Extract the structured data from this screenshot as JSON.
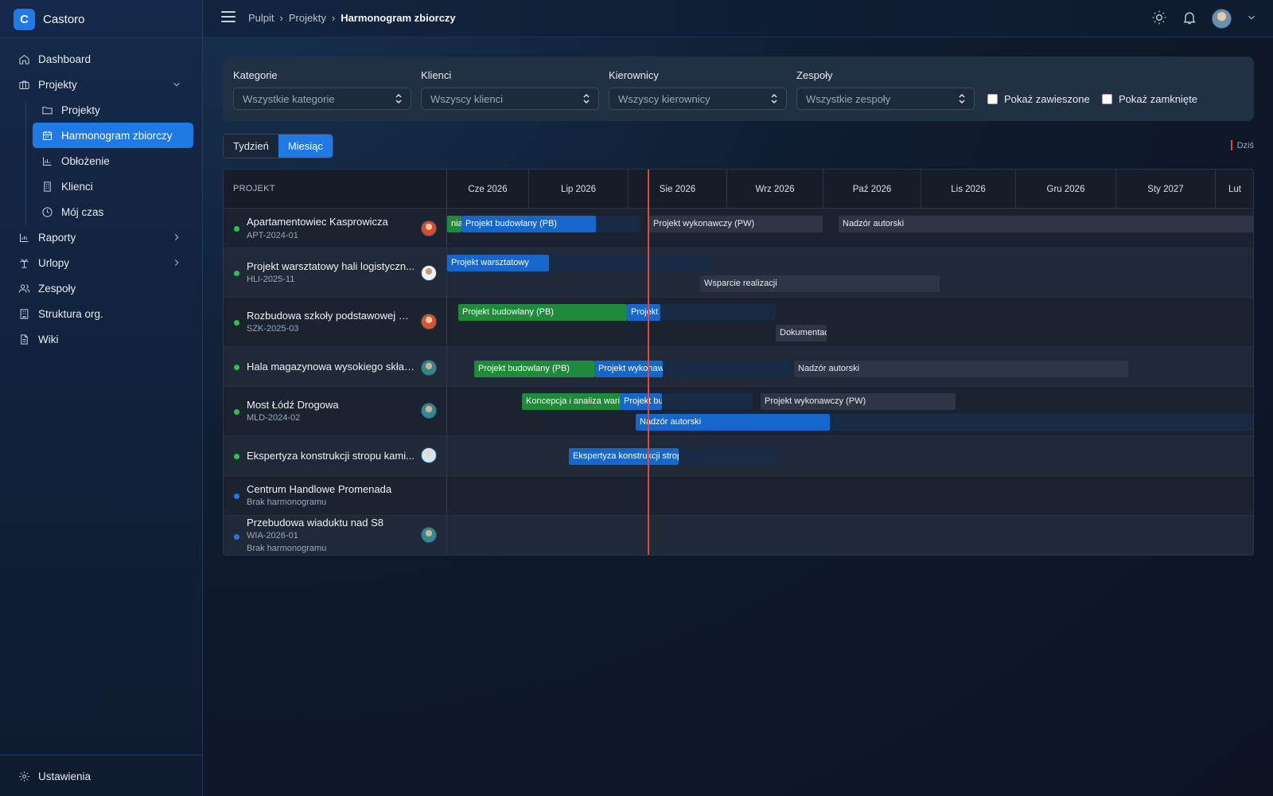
{
  "brand": {
    "letter": "C",
    "name": "Castoro"
  },
  "nav": {
    "dashboard": "Dashboard",
    "projekty": "Projekty",
    "projekty_sub": "Projekty",
    "harmonogram": "Harmonogram zbiorczy",
    "obciazenie": "Obłożenie",
    "klienci": "Klienci",
    "moj_czas": "Mój czas",
    "raporty": "Raporty",
    "urlopy": "Urlopy",
    "zespoly": "Zespoły",
    "struktura": "Struktura org.",
    "wiki": "Wiki",
    "ustawienia": "Ustawienia"
  },
  "breadcrumb": {
    "c1": "Pulpit",
    "c2": "Projekty",
    "c3": "Harmonogram zbiorczy",
    "sep": "›"
  },
  "filters": {
    "kategorie": {
      "label": "Kategorie",
      "value": "Wszystkie kategorie"
    },
    "klienci": {
      "label": "Klienci",
      "value": "Wszyscy klienci"
    },
    "kierownicy": {
      "label": "Kierownicy",
      "value": "Wszyscy kierownicy"
    },
    "zespoly": {
      "label": "Zespoły",
      "value": "Wszystkie zespoły"
    },
    "zawieszone": "Pokaż zawieszone",
    "zamkniete": "Pokaż zamknięte"
  },
  "view": {
    "week": "Tydzień",
    "month": "Miesiąc",
    "today": "Dziś"
  },
  "gantt": {
    "col_header": "PROJEKT",
    "months": [
      "Cze 2026",
      "Lip 2026",
      "Sie 2026",
      "Wrz 2026",
      "Paź 2026",
      "Lis 2026",
      "Gru 2026",
      "Sty 2027",
      "Lut"
    ],
    "rows": [
      {
        "name": "Apartamentowiec Kasprowicza",
        "code": "APT-2024-01",
        "note": "",
        "status": "green",
        "bars": [
          {
            "label": "nia",
            "color": "green"
          },
          {
            "label": "Projekt budowlany (PB)",
            "color": "blue"
          },
          {
            "label": "",
            "color": "dark"
          },
          {
            "label": "Projekt wykonawczy (PW)",
            "color": "grey"
          },
          {
            "label": "Nadzór autorski",
            "color": "grey"
          }
        ]
      },
      {
        "name": "Projekt warsztatowy hali logistyczn...",
        "code": "HLI-2025-11",
        "note": "",
        "status": "green",
        "bars": [
          {
            "label": "Projekt warsztatowy",
            "color": "blue"
          },
          {
            "label": "",
            "color": "dark"
          },
          {
            "label": "Wsparcie realizacji",
            "color": "grey"
          }
        ]
      },
      {
        "name": "Rozbudowa szkoły podstawowej w ...",
        "code": "SZK-2025-03",
        "note": "",
        "status": "green",
        "bars": [
          {
            "label": "Projekt budowlany (PB)",
            "color": "green"
          },
          {
            "label": "Projekt wykonawczy (PW)",
            "color": "blue"
          },
          {
            "label": "",
            "color": "dark"
          },
          {
            "label": "Dokumentacja przetargowa",
            "color": "grey"
          }
        ]
      },
      {
        "name": "Hala magazynowa wysokiego skład...",
        "code": "",
        "note": "",
        "status": "green",
        "bars": [
          {
            "label": "Projekt budowlany (PB)",
            "color": "green"
          },
          {
            "label": "Projekt wykonawczy (PW) konstrukcji",
            "color": "blue"
          },
          {
            "label": "",
            "color": "dark"
          },
          {
            "label": "Nadzór autorski",
            "color": "grey"
          }
        ]
      },
      {
        "name": "Most Łódź Drogowa",
        "code": "MLD-2024-02",
        "note": "",
        "status": "green",
        "bars": [
          {
            "label": "Koncepcja i analiza wariantów",
            "color": "green"
          },
          {
            "label": "Projekt budowlany (PB)",
            "color": "blue"
          },
          {
            "label": "",
            "color": "dark"
          },
          {
            "label": "Projekt wykonawczy (PW)",
            "color": "grey"
          },
          {
            "label": "Nadzór autorski",
            "color": "blue"
          },
          {
            "label": "",
            "color": "dark"
          }
        ]
      },
      {
        "name": "Ekspertyza konstrukcji stropu kami...",
        "code": "",
        "note": "",
        "status": "green",
        "bars": [
          {
            "label": "Ekspertyza konstrukcji stropu",
            "color": "blue"
          },
          {
            "label": "",
            "color": "dark"
          }
        ]
      },
      {
        "name": "Centrum Handlowe Promenada",
        "code": "",
        "note": "Brak harmonogramu",
        "status": "blue",
        "bars": []
      },
      {
        "name": "Przebudowa wiaduktu nad S8",
        "code": "WIA-2026-01",
        "note": "Brak harmonogramu",
        "status": "blue",
        "bars": []
      }
    ]
  },
  "colors": {
    "accent": "#1f7ae6",
    "green": "#1f8a3a",
    "today": "#e5453c"
  }
}
